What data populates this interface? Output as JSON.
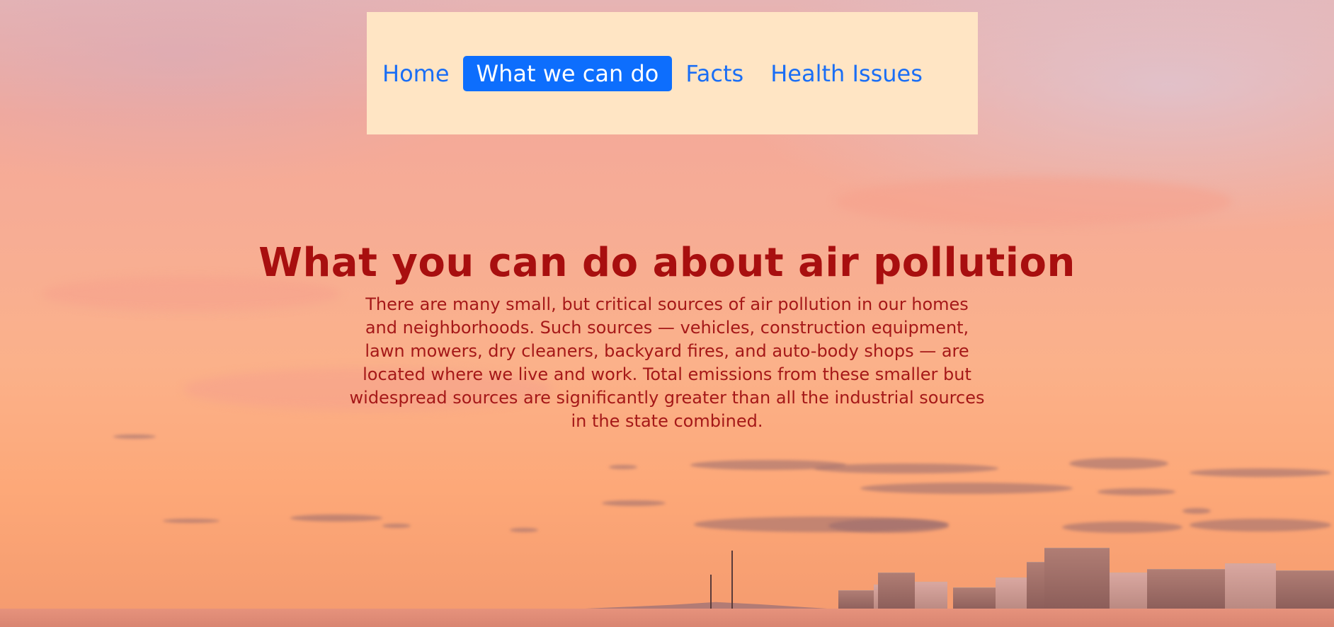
{
  "navbar": {
    "items": [
      {
        "label": "Home",
        "active": false
      },
      {
        "label": "What we can do",
        "active": true
      },
      {
        "label": "Facts",
        "active": false
      },
      {
        "label": "Health Issues",
        "active": false
      }
    ]
  },
  "main": {
    "title": "What you can do about air pollution",
    "intro": "There are many small, but critical sources of air pollution in our homes and neighborhoods. Such sources — vehicles, construction equipment, lawn mowers, dry cleaners, backyard fires, and auto-body shops — are located where we live and work. Total emissions from these smaller but widespread sources are significantly greater than all the industrial sources in the state combined."
  },
  "colors": {
    "nav_background": "#ffe5c4",
    "nav_link": "#1a6ef5",
    "nav_active_background": "#0d6efd",
    "title": "#a80f0f",
    "body_text": "#a51818"
  }
}
